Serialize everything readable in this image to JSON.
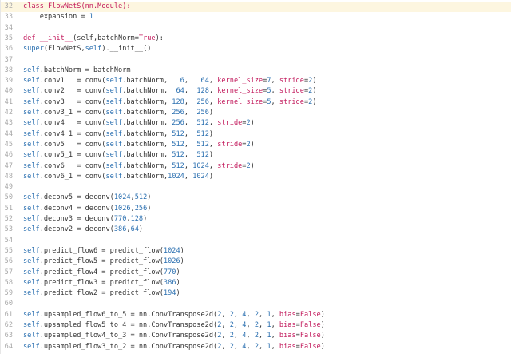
{
  "editor": {
    "lines": [
      {
        "n": "32",
        "hl": true,
        "tokens": [
          {
            "t": "class ",
            "c": "kw"
          },
          {
            "t": "FlowNetS",
            "c": "cls"
          },
          {
            "t": "(nn.Module):",
            "c": "cls"
          }
        ]
      },
      {
        "n": "33",
        "tokens": [
          {
            "t": "    expansion = ",
            "c": "txt"
          },
          {
            "t": "1",
            "c": "num"
          }
        ]
      },
      {
        "n": "34",
        "tokens": []
      },
      {
        "n": "35",
        "tokens": [
          {
            "t": "def ",
            "c": "kw"
          },
          {
            "t": "__init__",
            "c": "kw"
          },
          {
            "t": "(self,batchNorm=",
            "c": "txt"
          },
          {
            "t": "True",
            "c": "kw"
          },
          {
            "t": "):",
            "c": "txt"
          }
        ]
      },
      {
        "n": "36",
        "tokens": [
          {
            "t": "super",
            "c": "sf"
          },
          {
            "t": "(FlowNetS,",
            "c": "txt"
          },
          {
            "t": "self",
            "c": "sf"
          },
          {
            "t": ").__init__()",
            "c": "txt"
          }
        ]
      },
      {
        "n": "37",
        "tokens": []
      },
      {
        "n": "38",
        "tokens": [
          {
            "t": "self",
            "c": "sf"
          },
          {
            "t": ".batchNorm = batchNorm",
            "c": "txt"
          }
        ]
      },
      {
        "n": "39",
        "tokens": [
          {
            "t": "self",
            "c": "sf"
          },
          {
            "t": ".conv1   = conv(",
            "c": "txt"
          },
          {
            "t": "self",
            "c": "sf"
          },
          {
            "t": ".batchNorm,   ",
            "c": "txt"
          },
          {
            "t": "6",
            "c": "num"
          },
          {
            "t": ",   ",
            "c": "txt"
          },
          {
            "t": "64",
            "c": "num"
          },
          {
            "t": ", ",
            "c": "txt"
          },
          {
            "t": "kernel_size",
            "c": "kwa"
          },
          {
            "t": "=",
            "c": "txt"
          },
          {
            "t": "7",
            "c": "num"
          },
          {
            "t": ", ",
            "c": "txt"
          },
          {
            "t": "stride",
            "c": "kwa"
          },
          {
            "t": "=",
            "c": "txt"
          },
          {
            "t": "2",
            "c": "num"
          },
          {
            "t": ")",
            "c": "txt"
          }
        ]
      },
      {
        "n": "40",
        "tokens": [
          {
            "t": "self",
            "c": "sf"
          },
          {
            "t": ".conv2   = conv(",
            "c": "txt"
          },
          {
            "t": "self",
            "c": "sf"
          },
          {
            "t": ".batchNorm,  ",
            "c": "txt"
          },
          {
            "t": "64",
            "c": "num"
          },
          {
            "t": ",  ",
            "c": "txt"
          },
          {
            "t": "128",
            "c": "num"
          },
          {
            "t": ", ",
            "c": "txt"
          },
          {
            "t": "kernel_size",
            "c": "kwa"
          },
          {
            "t": "=",
            "c": "txt"
          },
          {
            "t": "5",
            "c": "num"
          },
          {
            "t": ", ",
            "c": "txt"
          },
          {
            "t": "stride",
            "c": "kwa"
          },
          {
            "t": "=",
            "c": "txt"
          },
          {
            "t": "2",
            "c": "num"
          },
          {
            "t": ")",
            "c": "txt"
          }
        ]
      },
      {
        "n": "41",
        "tokens": [
          {
            "t": "self",
            "c": "sf"
          },
          {
            "t": ".conv3   = conv(",
            "c": "txt"
          },
          {
            "t": "self",
            "c": "sf"
          },
          {
            "t": ".batchNorm, ",
            "c": "txt"
          },
          {
            "t": "128",
            "c": "num"
          },
          {
            "t": ",  ",
            "c": "txt"
          },
          {
            "t": "256",
            "c": "num"
          },
          {
            "t": ", ",
            "c": "txt"
          },
          {
            "t": "kernel_size",
            "c": "kwa"
          },
          {
            "t": "=",
            "c": "txt"
          },
          {
            "t": "5",
            "c": "num"
          },
          {
            "t": ", ",
            "c": "txt"
          },
          {
            "t": "stride",
            "c": "kwa"
          },
          {
            "t": "=",
            "c": "txt"
          },
          {
            "t": "2",
            "c": "num"
          },
          {
            "t": ")",
            "c": "txt"
          }
        ]
      },
      {
        "n": "42",
        "tokens": [
          {
            "t": "self",
            "c": "sf"
          },
          {
            "t": ".conv3_1 = conv(",
            "c": "txt"
          },
          {
            "t": "self",
            "c": "sf"
          },
          {
            "t": ".batchNorm, ",
            "c": "txt"
          },
          {
            "t": "256",
            "c": "num"
          },
          {
            "t": ",  ",
            "c": "txt"
          },
          {
            "t": "256",
            "c": "num"
          },
          {
            "t": ")",
            "c": "txt"
          }
        ]
      },
      {
        "n": "43",
        "tokens": [
          {
            "t": "self",
            "c": "sf"
          },
          {
            "t": ".conv4   = conv(",
            "c": "txt"
          },
          {
            "t": "self",
            "c": "sf"
          },
          {
            "t": ".batchNorm, ",
            "c": "txt"
          },
          {
            "t": "256",
            "c": "num"
          },
          {
            "t": ",  ",
            "c": "txt"
          },
          {
            "t": "512",
            "c": "num"
          },
          {
            "t": ", ",
            "c": "txt"
          },
          {
            "t": "stride",
            "c": "kwa"
          },
          {
            "t": "=",
            "c": "txt"
          },
          {
            "t": "2",
            "c": "num"
          },
          {
            "t": ")",
            "c": "txt"
          }
        ]
      },
      {
        "n": "44",
        "tokens": [
          {
            "t": "self",
            "c": "sf"
          },
          {
            "t": ".conv4_1 = conv(",
            "c": "txt"
          },
          {
            "t": "self",
            "c": "sf"
          },
          {
            "t": ".batchNorm, ",
            "c": "txt"
          },
          {
            "t": "512",
            "c": "num"
          },
          {
            "t": ",  ",
            "c": "txt"
          },
          {
            "t": "512",
            "c": "num"
          },
          {
            "t": ")",
            "c": "txt"
          }
        ]
      },
      {
        "n": "45",
        "tokens": [
          {
            "t": "self",
            "c": "sf"
          },
          {
            "t": ".conv5   = conv(",
            "c": "txt"
          },
          {
            "t": "self",
            "c": "sf"
          },
          {
            "t": ".batchNorm, ",
            "c": "txt"
          },
          {
            "t": "512",
            "c": "num"
          },
          {
            "t": ",  ",
            "c": "txt"
          },
          {
            "t": "512",
            "c": "num"
          },
          {
            "t": ", ",
            "c": "txt"
          },
          {
            "t": "stride",
            "c": "kwa"
          },
          {
            "t": "=",
            "c": "txt"
          },
          {
            "t": "2",
            "c": "num"
          },
          {
            "t": ")",
            "c": "txt"
          }
        ]
      },
      {
        "n": "46",
        "tokens": [
          {
            "t": "self",
            "c": "sf"
          },
          {
            "t": ".conv5_1 = conv(",
            "c": "txt"
          },
          {
            "t": "self",
            "c": "sf"
          },
          {
            "t": ".batchNorm, ",
            "c": "txt"
          },
          {
            "t": "512",
            "c": "num"
          },
          {
            "t": ",  ",
            "c": "txt"
          },
          {
            "t": "512",
            "c": "num"
          },
          {
            "t": ")",
            "c": "txt"
          }
        ]
      },
      {
        "n": "47",
        "tokens": [
          {
            "t": "self",
            "c": "sf"
          },
          {
            "t": ".conv6   = conv(",
            "c": "txt"
          },
          {
            "t": "self",
            "c": "sf"
          },
          {
            "t": ".batchNorm, ",
            "c": "txt"
          },
          {
            "t": "512",
            "c": "num"
          },
          {
            "t": ", ",
            "c": "txt"
          },
          {
            "t": "1024",
            "c": "num"
          },
          {
            "t": ", ",
            "c": "txt"
          },
          {
            "t": "stride",
            "c": "kwa"
          },
          {
            "t": "=",
            "c": "txt"
          },
          {
            "t": "2",
            "c": "num"
          },
          {
            "t": ")",
            "c": "txt"
          }
        ]
      },
      {
        "n": "48",
        "tokens": [
          {
            "t": "self",
            "c": "sf"
          },
          {
            "t": ".conv6_1 = conv(",
            "c": "txt"
          },
          {
            "t": "self",
            "c": "sf"
          },
          {
            "t": ".batchNorm,",
            "c": "txt"
          },
          {
            "t": "1024",
            "c": "num"
          },
          {
            "t": ", ",
            "c": "txt"
          },
          {
            "t": "1024",
            "c": "num"
          },
          {
            "t": ")",
            "c": "txt"
          }
        ]
      },
      {
        "n": "49",
        "tokens": []
      },
      {
        "n": "50",
        "tokens": [
          {
            "t": "self",
            "c": "sf"
          },
          {
            "t": ".deconv5 = deconv(",
            "c": "txt"
          },
          {
            "t": "1024",
            "c": "num"
          },
          {
            "t": ",",
            "c": "txt"
          },
          {
            "t": "512",
            "c": "num"
          },
          {
            "t": ")",
            "c": "txt"
          }
        ]
      },
      {
        "n": "51",
        "tokens": [
          {
            "t": "self",
            "c": "sf"
          },
          {
            "t": ".deconv4 = deconv(",
            "c": "txt"
          },
          {
            "t": "1026",
            "c": "num"
          },
          {
            "t": ",",
            "c": "txt"
          },
          {
            "t": "256",
            "c": "num"
          },
          {
            "t": ")",
            "c": "txt"
          }
        ]
      },
      {
        "n": "52",
        "tokens": [
          {
            "t": "self",
            "c": "sf"
          },
          {
            "t": ".deconv3 = deconv(",
            "c": "txt"
          },
          {
            "t": "770",
            "c": "num"
          },
          {
            "t": ",",
            "c": "txt"
          },
          {
            "t": "128",
            "c": "num"
          },
          {
            "t": ")",
            "c": "txt"
          }
        ]
      },
      {
        "n": "53",
        "tokens": [
          {
            "t": "self",
            "c": "sf"
          },
          {
            "t": ".deconv2 = deconv(",
            "c": "txt"
          },
          {
            "t": "386",
            "c": "num"
          },
          {
            "t": ",",
            "c": "txt"
          },
          {
            "t": "64",
            "c": "num"
          },
          {
            "t": ")",
            "c": "txt"
          }
        ]
      },
      {
        "n": "54",
        "tokens": []
      },
      {
        "n": "55",
        "tokens": [
          {
            "t": "self",
            "c": "sf"
          },
          {
            "t": ".predict_flow6 = predict_flow(",
            "c": "txt"
          },
          {
            "t": "1024",
            "c": "num"
          },
          {
            "t": ")",
            "c": "txt"
          }
        ]
      },
      {
        "n": "56",
        "tokens": [
          {
            "t": "self",
            "c": "sf"
          },
          {
            "t": ".predict_flow5 = predict_flow(",
            "c": "txt"
          },
          {
            "t": "1026",
            "c": "num"
          },
          {
            "t": ")",
            "c": "txt"
          }
        ]
      },
      {
        "n": "57",
        "tokens": [
          {
            "t": "self",
            "c": "sf"
          },
          {
            "t": ".predict_flow4 = predict_flow(",
            "c": "txt"
          },
          {
            "t": "770",
            "c": "num"
          },
          {
            "t": ")",
            "c": "txt"
          }
        ]
      },
      {
        "n": "58",
        "tokens": [
          {
            "t": "self",
            "c": "sf"
          },
          {
            "t": ".predict_flow3 = predict_flow(",
            "c": "txt"
          },
          {
            "t": "386",
            "c": "num"
          },
          {
            "t": ")",
            "c": "txt"
          }
        ]
      },
      {
        "n": "59",
        "tokens": [
          {
            "t": "self",
            "c": "sf"
          },
          {
            "t": ".predict_flow2 = predict_flow(",
            "c": "txt"
          },
          {
            "t": "194",
            "c": "num"
          },
          {
            "t": ")",
            "c": "txt"
          }
        ]
      },
      {
        "n": "60",
        "tokens": []
      },
      {
        "n": "61",
        "tokens": [
          {
            "t": "self",
            "c": "sf"
          },
          {
            "t": ".upsampled_flow6_to_5 = nn.ConvTranspose2d(",
            "c": "txt"
          },
          {
            "t": "2",
            "c": "num"
          },
          {
            "t": ", ",
            "c": "txt"
          },
          {
            "t": "2",
            "c": "num"
          },
          {
            "t": ", ",
            "c": "txt"
          },
          {
            "t": "4",
            "c": "num"
          },
          {
            "t": ", ",
            "c": "txt"
          },
          {
            "t": "2",
            "c": "num"
          },
          {
            "t": ", ",
            "c": "txt"
          },
          {
            "t": "1",
            "c": "num"
          },
          {
            "t": ", ",
            "c": "txt"
          },
          {
            "t": "bias",
            "c": "kwa"
          },
          {
            "t": "=",
            "c": "txt"
          },
          {
            "t": "False",
            "c": "kw"
          },
          {
            "t": ")",
            "c": "txt"
          }
        ]
      },
      {
        "n": "62",
        "tokens": [
          {
            "t": "self",
            "c": "sf"
          },
          {
            "t": ".upsampled_flow5_to_4 = nn.ConvTranspose2d(",
            "c": "txt"
          },
          {
            "t": "2",
            "c": "num"
          },
          {
            "t": ", ",
            "c": "txt"
          },
          {
            "t": "2",
            "c": "num"
          },
          {
            "t": ", ",
            "c": "txt"
          },
          {
            "t": "4",
            "c": "num"
          },
          {
            "t": ", ",
            "c": "txt"
          },
          {
            "t": "2",
            "c": "num"
          },
          {
            "t": ", ",
            "c": "txt"
          },
          {
            "t": "1",
            "c": "num"
          },
          {
            "t": ", ",
            "c": "txt"
          },
          {
            "t": "bias",
            "c": "kwa"
          },
          {
            "t": "=",
            "c": "txt"
          },
          {
            "t": "False",
            "c": "kw"
          },
          {
            "t": ")",
            "c": "txt"
          }
        ]
      },
      {
        "n": "63",
        "tokens": [
          {
            "t": "self",
            "c": "sf"
          },
          {
            "t": ".upsampled_flow4_to_3 = nn.ConvTranspose2d(",
            "c": "txt"
          },
          {
            "t": "2",
            "c": "num"
          },
          {
            "t": ", ",
            "c": "txt"
          },
          {
            "t": "2",
            "c": "num"
          },
          {
            "t": ", ",
            "c": "txt"
          },
          {
            "t": "4",
            "c": "num"
          },
          {
            "t": ", ",
            "c": "txt"
          },
          {
            "t": "2",
            "c": "num"
          },
          {
            "t": ", ",
            "c": "txt"
          },
          {
            "t": "1",
            "c": "num"
          },
          {
            "t": ", ",
            "c": "txt"
          },
          {
            "t": "bias",
            "c": "kwa"
          },
          {
            "t": "=",
            "c": "txt"
          },
          {
            "t": "False",
            "c": "kw"
          },
          {
            "t": ")",
            "c": "txt"
          }
        ]
      },
      {
        "n": "64",
        "tokens": [
          {
            "t": "self",
            "c": "sf"
          },
          {
            "t": ".upsampled_flow3_to_2 = nn.ConvTranspose2d(",
            "c": "txt"
          },
          {
            "t": "2",
            "c": "num"
          },
          {
            "t": ", ",
            "c": "txt"
          },
          {
            "t": "2",
            "c": "num"
          },
          {
            "t": ", ",
            "c": "txt"
          },
          {
            "t": "4",
            "c": "num"
          },
          {
            "t": ", ",
            "c": "txt"
          },
          {
            "t": "2",
            "c": "num"
          },
          {
            "t": ", ",
            "c": "txt"
          },
          {
            "t": "1",
            "c": "num"
          },
          {
            "t": ", ",
            "c": "txt"
          },
          {
            "t": "bias",
            "c": "kwa"
          },
          {
            "t": "=",
            "c": "txt"
          },
          {
            "t": "False",
            "c": "kw"
          },
          {
            "t": ")",
            "c": "txt"
          }
        ]
      }
    ]
  }
}
